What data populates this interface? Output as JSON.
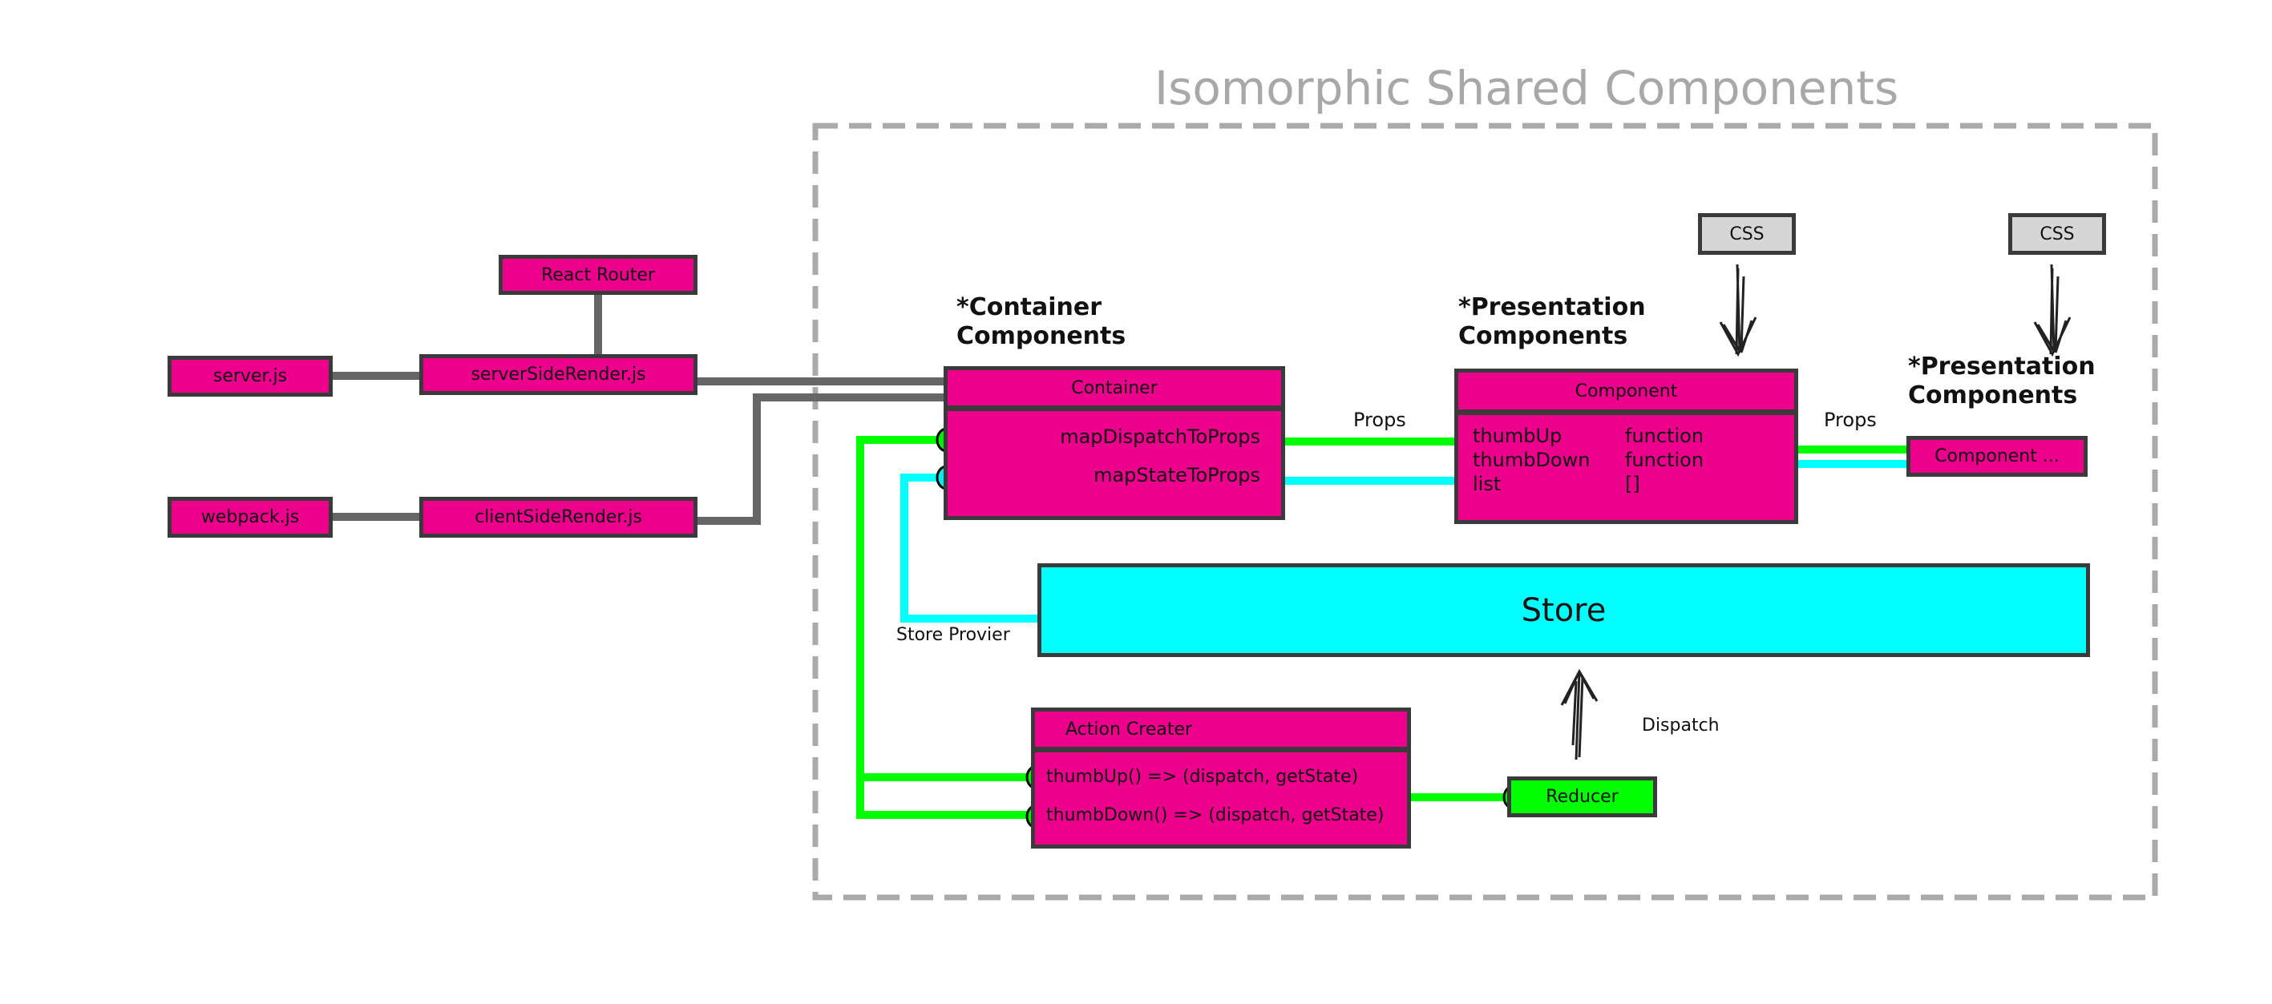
{
  "group": {
    "title": "Isomorphic Shared Components"
  },
  "colors": {
    "component_fill": "#ec008c",
    "store_fill": "#00ffff",
    "reducer_fill": "#00ff00",
    "css_fill": "#d6d6d6",
    "wire_gray": "#666666",
    "wire_green": "#00ff00",
    "wire_cyan": "#00ffff",
    "boundary_dash": "#aaaaaa"
  },
  "nodes": {
    "react_router": "React Router",
    "server_js": "server.js",
    "server_side_render": "serverSideRender.js",
    "webpack_js": "webpack.js",
    "client_side_render": "clientSideRender.js",
    "css_1": "CSS",
    "css_2": "CSS",
    "store": "Store",
    "reducer": "Reducer",
    "component_more": "Component ..."
  },
  "sections": {
    "container_line1": "*Container",
    "container_line2": "Components",
    "presentation_line1": "*Presentation",
    "presentation_line2": "Components",
    "presentation2_line1": "*Presentation",
    "presentation2_line2": "Components"
  },
  "container": {
    "title": "Container",
    "rows": [
      "mapDispatchToProps",
      "mapStateToProps"
    ]
  },
  "component": {
    "title": "Component",
    "props": [
      {
        "name": "thumbUp",
        "type": "function"
      },
      {
        "name": "thumbDown",
        "type": "function"
      },
      {
        "name": "list",
        "type": "[]"
      }
    ]
  },
  "action_creator": {
    "title": "Action Creater",
    "rows": [
      "thumbUp() => (dispatch, getState)",
      "thumbDown() => (dispatch, getState)"
    ]
  },
  "edge_labels": {
    "props_1": "Props",
    "props_2": "Props",
    "store_provider": "Store Provier",
    "dispatch": "Dispatch"
  }
}
